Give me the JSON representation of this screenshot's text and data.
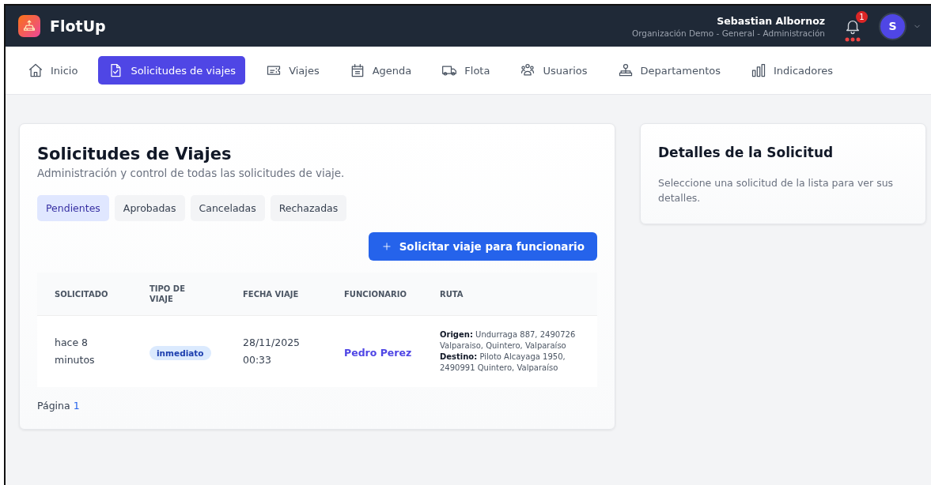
{
  "app": {
    "name": "FlotUp"
  },
  "user": {
    "name": "Sebastian Albornoz",
    "context": "Organización Demo - General - Administración",
    "notifications": "1",
    "avatar": "S"
  },
  "nav": [
    {
      "label": "Inicio",
      "selected": false
    },
    {
      "label": "Solicitudes de viajes",
      "selected": true
    },
    {
      "label": "Viajes",
      "selected": false
    },
    {
      "label": "Agenda",
      "selected": false
    },
    {
      "label": "Flota",
      "selected": false
    },
    {
      "label": "Usuarios",
      "selected": false
    },
    {
      "label": "Departamentos",
      "selected": false
    },
    {
      "label": "Indicadores",
      "selected": false
    }
  ],
  "main": {
    "title": "Solicitudes de Viajes",
    "subtitle": "Administración y control de todas las solicitudes de viaje.",
    "tabs": [
      {
        "label": "Pendientes",
        "selected": true
      },
      {
        "label": "Aprobadas",
        "selected": false
      },
      {
        "label": "Canceladas",
        "selected": false
      },
      {
        "label": "Rechazadas",
        "selected": false
      }
    ],
    "action_button": "Solicitar viaje para funcionario",
    "table": {
      "columns": [
        "SOLICITADO",
        "TIPO DE VIAJE",
        "FECHA VIAJE",
        "FUNCIONARIO",
        "RUTA"
      ],
      "rows": [
        {
          "requested": "hace 8 minutos",
          "type": "inmediato",
          "date": "28/11/2025 00:33",
          "employee": "Pedro Perez",
          "route": [
            "**Origen:** Undurraga 887, 2490726 Valparaiso, Quintero, Valparaíso",
            "**Destino:** Piloto Alcayaga 1950, 2490991 Quintero, Valparaíso"
          ]
        }
      ]
    },
    "pagination": {
      "label": "Página",
      "page": "1"
    }
  },
  "details": {
    "title": "Detalles de la Solicitud",
    "message": "Seleccione una solicitud de la lista para ver sus detalles."
  }
}
